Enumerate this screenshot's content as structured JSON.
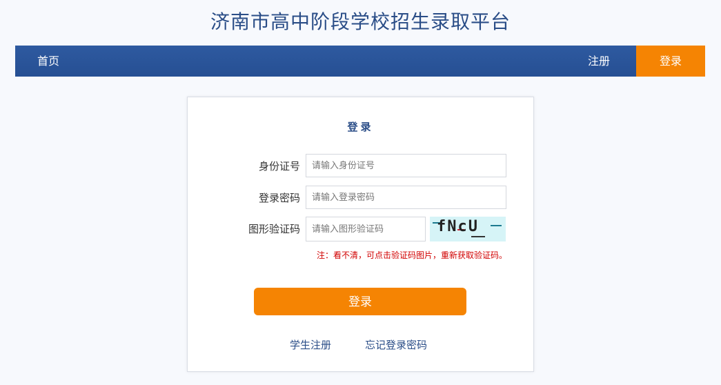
{
  "header": {
    "title": "济南市高中阶段学校招生录取平台"
  },
  "nav": {
    "home": "首页",
    "register": "注册",
    "login": "登录"
  },
  "login_form": {
    "title": "登录",
    "id_label": "身份证号",
    "id_placeholder": "请输入身份证号",
    "password_label": "登录密码",
    "password_placeholder": "请输入登录密码",
    "captcha_label": "图形验证码",
    "captcha_placeholder": "请输入图形验证码",
    "captcha_text": "fNcU",
    "hint": "注：看不清，可点击验证码图片，重新获取验证码。",
    "submit": "登录",
    "student_register": "学生注册",
    "forgot_password": "忘记登录密码"
  },
  "colors": {
    "nav_blue": "#2a4d87",
    "accent_orange": "#f58403",
    "hint_red": "#d10000"
  }
}
